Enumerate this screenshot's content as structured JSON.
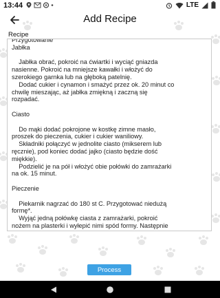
{
  "status_bar": {
    "time": "13:44",
    "network": "LTE",
    "left_icons": [
      "location-icon",
      "mail-icon",
      "settings-icon",
      "dot-icon"
    ],
    "right_icons": [
      "alarm-icon",
      "wifi-icon",
      "lte-icon",
      "battery-icon"
    ]
  },
  "app_bar": {
    "title": "Add Recipe",
    "back_icon": "arrow-back-icon"
  },
  "recipe_field": {
    "label": "Recipe",
    "value": "Przygotowanie\nJabłka\n\n    Jabłka obrać, pokroić na ćwiartki i wyciąć gniazda\nnasienne. Pokroić na mniejsze kawałki i włożyć do\nszerokiego garnka lub na głęboką patelnię.\n    Dodać cukier i cynamon i smażyć przez ok. 20 minut co\nchwilę mieszając, aż jabłka zmiękną i zaczną się\nrozpadać.\n\nCiasto\n\n    Do mąki dodać pokrojone w kostkę zimne masło,\nproszek do pieczenia, cukier i cukier waniliowy.\n    Składniki połączyć w jednolite ciasto (mikserem lub\nręcznie), pod koniec dodać jajko (ciasto będzie dość\nmiękkie).\n    Podzielić je na pół i włożyć obie połówki do zamrażarki\nna ok. 15 minut.\n\nPieczenie\n\n    Piekarnik nagrzać do 180 st C. Przygotować niedużą\nformę*.\n    Wyjąć jedną połówkę ciasta z zamrażarki, pokroić\nnożem na plasterki i wyłepić nimi spód formy. Następnie\nwyłożyć na to jabłka.\n    Pozostałe ciasto zetrzeć na tarce bezpośrednio na\njabłka (lub pokroić ciasto na plasterki i ułożyć na\nwierzchu).\n    Wstawić do piekarnika i piec przez ok. 50 minut lub na\nzłoty kolor. Upieczoną szarlotkę przestudzić i posypać\ncukrem pudrem."
  },
  "process_button": {
    "label": "Process",
    "color": "#3ea2e4"
  },
  "nav_bar": {
    "icons": [
      "back-triangle-icon",
      "home-circle-icon",
      "recents-square-icon"
    ]
  }
}
